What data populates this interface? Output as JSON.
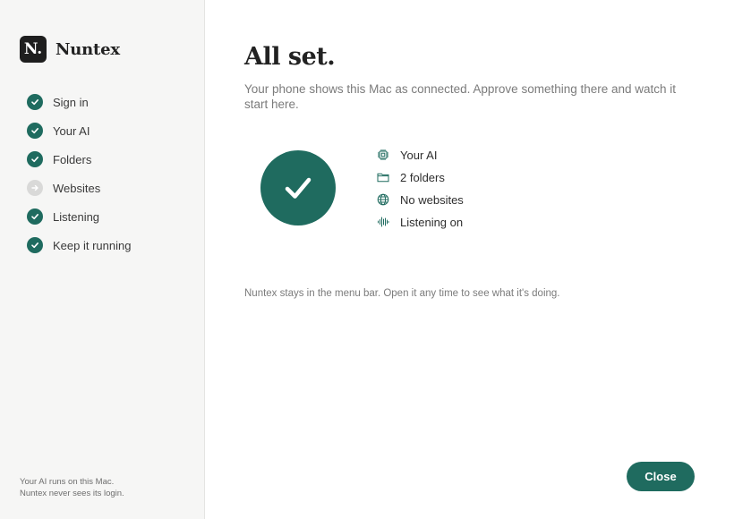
{
  "sidebar": {
    "logo_letter": "N.",
    "brand_name": "Nuntex",
    "steps": [
      {
        "label": "Sign in",
        "status": "done"
      },
      {
        "label": "Your AI",
        "status": "done"
      },
      {
        "label": "Folders",
        "status": "done"
      },
      {
        "label": "Websites",
        "status": "skipped"
      },
      {
        "label": "Listening",
        "status": "done"
      },
      {
        "label": "Keep it running",
        "status": "done"
      }
    ],
    "footer_line1": "Your AI runs on this Mac.",
    "footer_line2": "Nuntex never sees its login."
  },
  "main": {
    "title": "All set.",
    "subtitle": "Your phone shows this Mac as connected. Approve something there and watch it start here.",
    "summary": [
      {
        "icon": "chip-icon",
        "label": "Your AI"
      },
      {
        "icon": "folder-icon",
        "label": "2 folders"
      },
      {
        "icon": "globe-icon",
        "label": "No websites"
      },
      {
        "icon": "waveform-icon",
        "label": "Listening on"
      }
    ],
    "note": "Nuntex stays in the menu bar. Open it any time to see what it's doing.",
    "close_label": "Close"
  },
  "colors": {
    "accent": "#1f6b5f",
    "sidebar_bg": "#f6f6f5",
    "pending_step": "#d9d9d8"
  }
}
